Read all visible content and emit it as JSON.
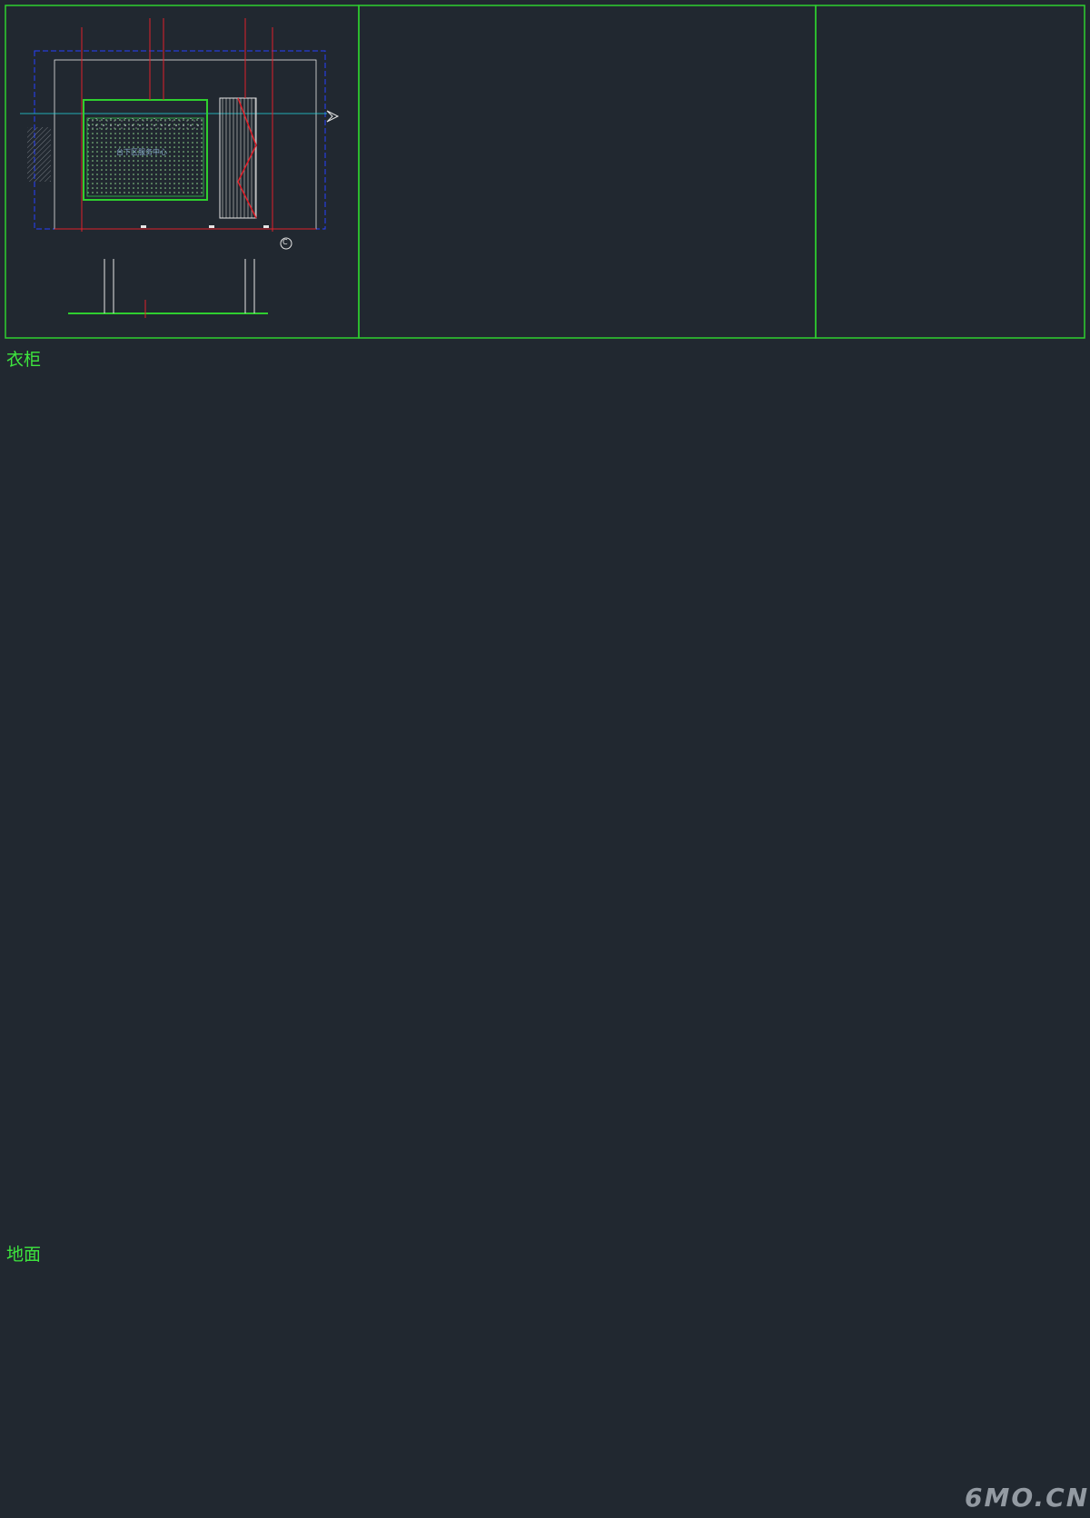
{
  "sections": {
    "wardrobe_title": "衣柜",
    "floor_title": "地面"
  },
  "labels": {
    "service_center_sign": "台下区服务中心",
    "marker_c": "C"
  },
  "watermark": "6MO.CN",
  "colors": {
    "background": "#212830",
    "frame_green": "#2fcf2f",
    "line_yellow": "#d7d04a",
    "line_red": "#e0202a",
    "line_blue": "#2840ff",
    "line_white": "#e6e6e6",
    "hatch_gray": "#6d747c",
    "fill_green": "#2aa845",
    "accent_magenta": "#c23ad0",
    "accent_cyan": "#23d8e0"
  }
}
